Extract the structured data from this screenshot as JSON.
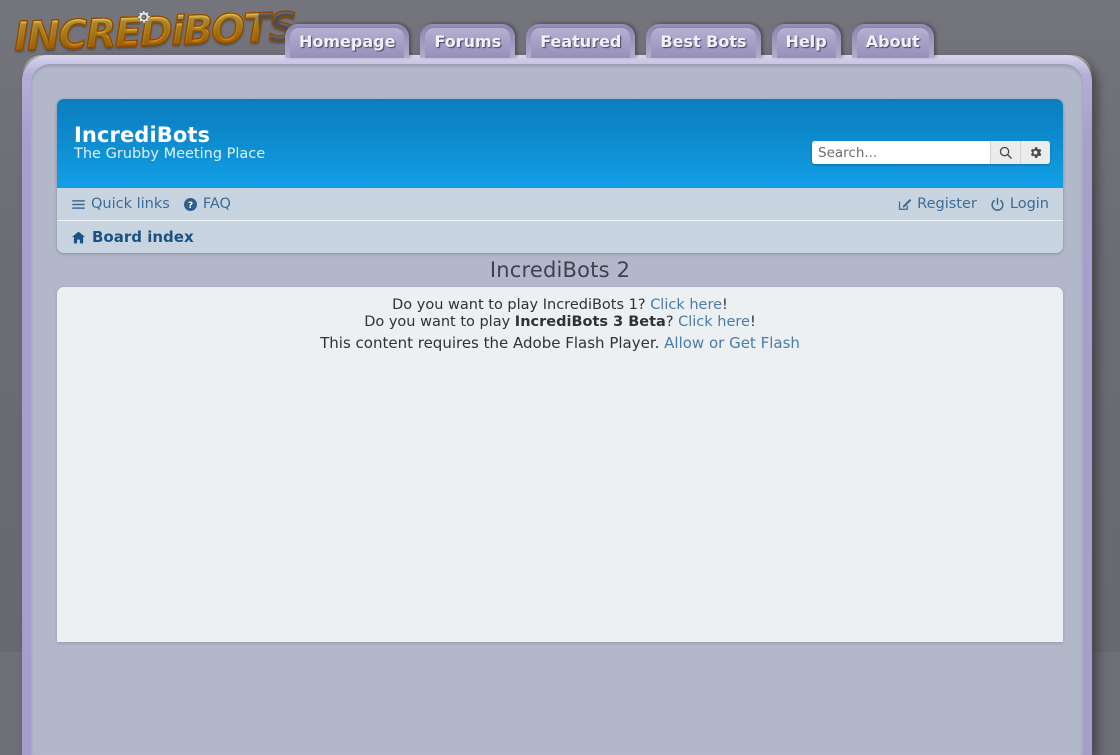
{
  "site": {
    "logo_text": "INCREDiBOTS",
    "logo_gear_icon": "gear-icon"
  },
  "topnav": {
    "tabs": [
      {
        "label": "Homepage"
      },
      {
        "label": "Forums"
      },
      {
        "label": "Featured"
      },
      {
        "label": "Best Bots"
      },
      {
        "label": "Help"
      },
      {
        "label": "About"
      }
    ]
  },
  "header": {
    "title": "IncrediBots",
    "description": "The Grubby Meeting Place",
    "search": {
      "placeholder": "Search...",
      "value": "",
      "search_icon": "search-icon",
      "advanced_icon": "gear-icon"
    }
  },
  "navbar": {
    "quick_links": {
      "label": "Quick links",
      "icon": "hamburger-icon"
    },
    "faq": {
      "label": "FAQ",
      "icon": "question-circle-icon"
    },
    "register": {
      "label": "Register",
      "icon": "pencil-square-icon"
    },
    "login": {
      "label": "Login",
      "icon": "power-icon"
    },
    "breadcrumb": {
      "label": "Board index",
      "icon": "home-icon"
    }
  },
  "page": {
    "title": "IncrediBots 2",
    "lines": {
      "one_prefix": "Do you want to play IncrediBots 1? ",
      "one_link": "Click here",
      "one_suffix": "!",
      "two_prefix": "Do you want to play ",
      "two_bold": "IncrediBots 3 Beta",
      "two_mid": "? ",
      "two_link": "Click here",
      "two_suffix": "!",
      "three_prefix": "This content requires the Adobe Flash Player. ",
      "three_link": "Allow or Get Flash"
    }
  },
  "colors": {
    "frame_purple": "#a79fce",
    "page_bg": "#b2b7ca",
    "header_blue": "#1096db",
    "navbar_blue": "#c9d4e1",
    "content_bg": "#ecf0f3",
    "link_blue": "#4b7ba8",
    "crumb_blue": "#1c5183",
    "logo_orange": "#f59a10",
    "desktop_grey": "#6e6e76"
  }
}
